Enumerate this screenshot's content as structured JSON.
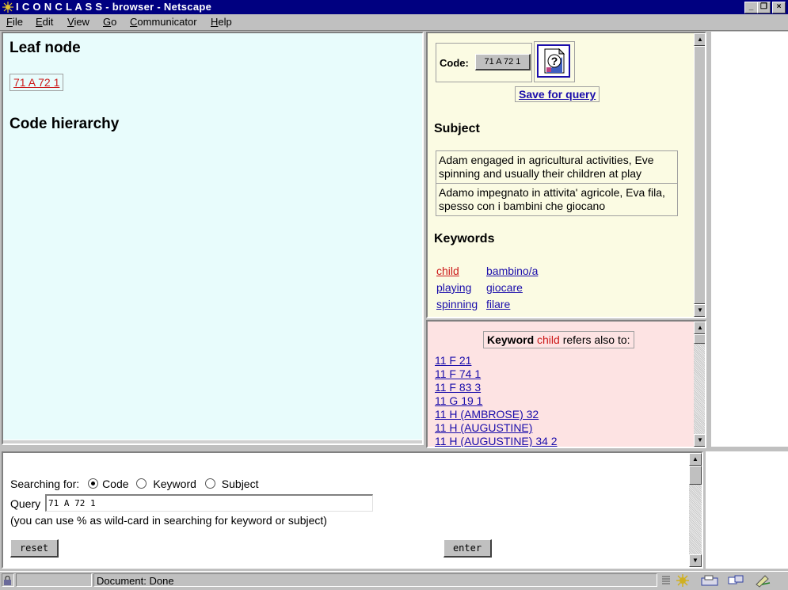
{
  "window": {
    "title": "ICONCLASS-browser - Netscape",
    "title_display": "I C O N C L A S S - browser - Netscape"
  },
  "menu": [
    "File",
    "Edit",
    "View",
    "Go",
    "Communicator",
    "Help"
  ],
  "left": {
    "leaf_heading": "Leaf node",
    "leaf_code": "71 A 72 1",
    "hierarchy_heading": "Code hierarchy"
  },
  "code_panel": {
    "code_label": "Code:",
    "code_value": "71 A 72 1",
    "save_link": "Save for query",
    "subject_heading": "Subject",
    "subjects": [
      "Adam engaged in agricultural activities, Eve spinning and usually their children at play",
      "Adamo impegnato in attivita' agricole, Eva fila, spesso con i bambini che giocano"
    ],
    "keywords_heading": "Keywords",
    "keywords": [
      {
        "en": "child",
        "it": "bambino/a"
      },
      {
        "en": "playing",
        "it": "giocare"
      },
      {
        "en": "spinning",
        "it": "filare"
      }
    ]
  },
  "keyword_panel": {
    "prefix": "Keyword",
    "keyword": "child",
    "suffix": "refers also to:",
    "codes": [
      "11 F 21",
      "11 F 74 1",
      "11 F 83 3",
      "11 G 19 1",
      "11 H (AMBROSE) 32",
      "11 H (AUGUSTINE)",
      "11 H (AUGUSTINE) 34 2"
    ]
  },
  "search": {
    "searching_for_label": "Searching for:",
    "options": [
      "Code",
      "Keyword",
      "Subject"
    ],
    "selected": "Code",
    "query_label": "Query",
    "query_value": "71 A 72 1",
    "hint": "(you can use % as wild-card in searching for keyword or subject)",
    "reset_label": "reset",
    "enter_label": "enter"
  },
  "status": {
    "text": "Document: Done"
  },
  "colors": {
    "left_bg": "#e8fcfc",
    "code_bg": "#fbfbe3",
    "keyword_bg": "#fde3e3",
    "titlebar": "#000080",
    "link": "#1a0dab",
    "highlight": "#cc1a1a"
  }
}
